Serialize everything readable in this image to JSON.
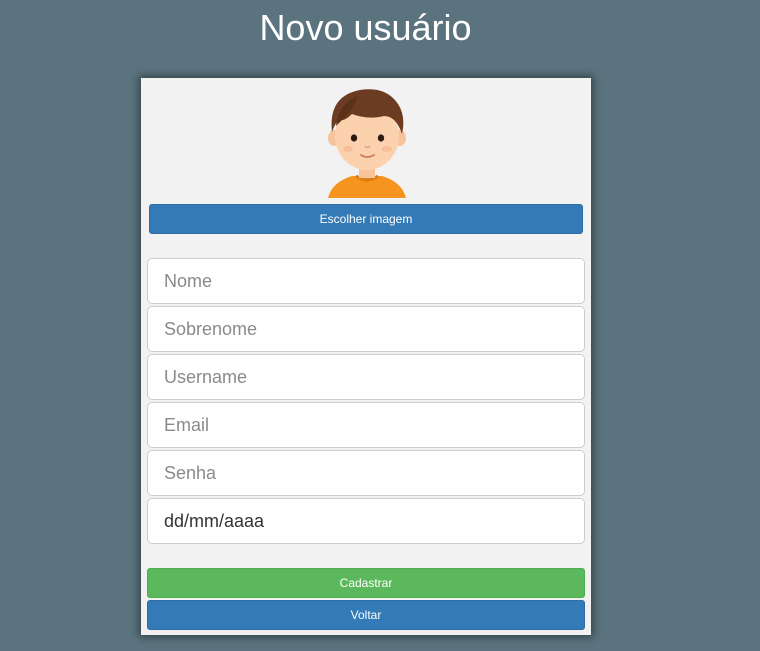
{
  "header": {
    "title": "Novo usuário"
  },
  "avatar": {
    "icon": "avatar-boy-icon"
  },
  "form": {
    "choose_image_label": "Escolher imagem",
    "fields": [
      {
        "placeholder": "Nome",
        "value": ""
      },
      {
        "placeholder": "Sobrenome",
        "value": ""
      },
      {
        "placeholder": "Username",
        "value": ""
      },
      {
        "placeholder": "Email",
        "value": ""
      },
      {
        "placeholder": "Senha",
        "value": ""
      },
      {
        "placeholder": "",
        "value": "dd/mm/aaaa"
      }
    ],
    "submit_label": "Cadastrar",
    "back_label": "Voltar"
  },
  "colors": {
    "background": "#5a737e",
    "primary": "#337ab7",
    "success": "#5cb85c",
    "card": "#f2f2f2"
  }
}
